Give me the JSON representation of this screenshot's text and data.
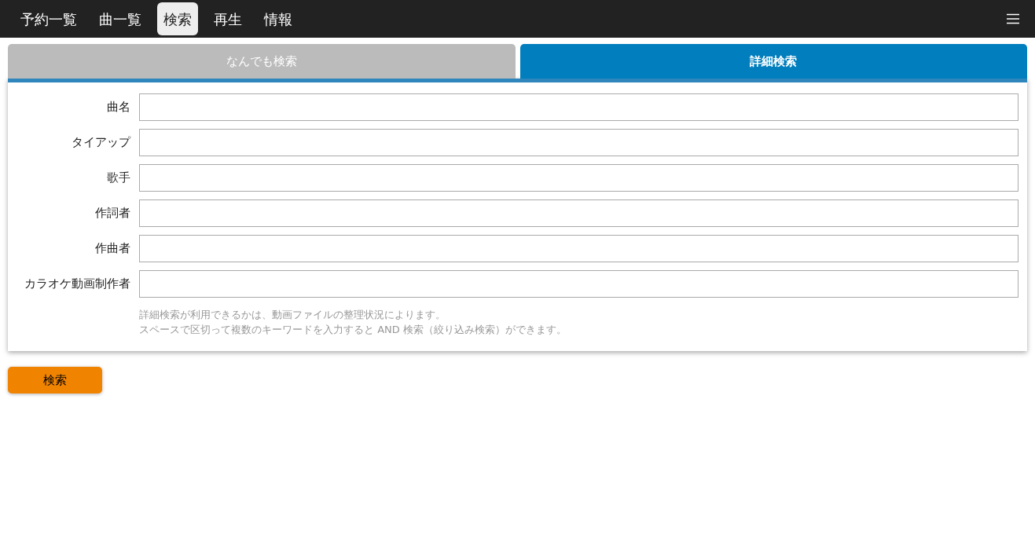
{
  "nav": {
    "items": [
      {
        "label": "予約一覧",
        "selected": false
      },
      {
        "label": "曲一覧",
        "selected": false
      },
      {
        "label": "検索",
        "selected": true
      },
      {
        "label": "再生",
        "selected": false
      },
      {
        "label": "情報",
        "selected": false
      }
    ]
  },
  "tabs": [
    {
      "label": "なんでも検索",
      "selected": false
    },
    {
      "label": "詳細検索",
      "selected": true
    }
  ],
  "form": {
    "fields": [
      {
        "label": "曲名"
      },
      {
        "label": "タイアップ"
      },
      {
        "label": "歌手"
      },
      {
        "label": "作詞者"
      },
      {
        "label": "作曲者"
      },
      {
        "label": "カラオケ動画制作者"
      }
    ],
    "notes": [
      "詳細検索が利用できるかは、動画ファイルの整理状況によります。",
      "スペースで区切って複数のキーワードを入力すると AND 検索（絞り込み検索）ができます。"
    ]
  },
  "search_button": "検索"
}
